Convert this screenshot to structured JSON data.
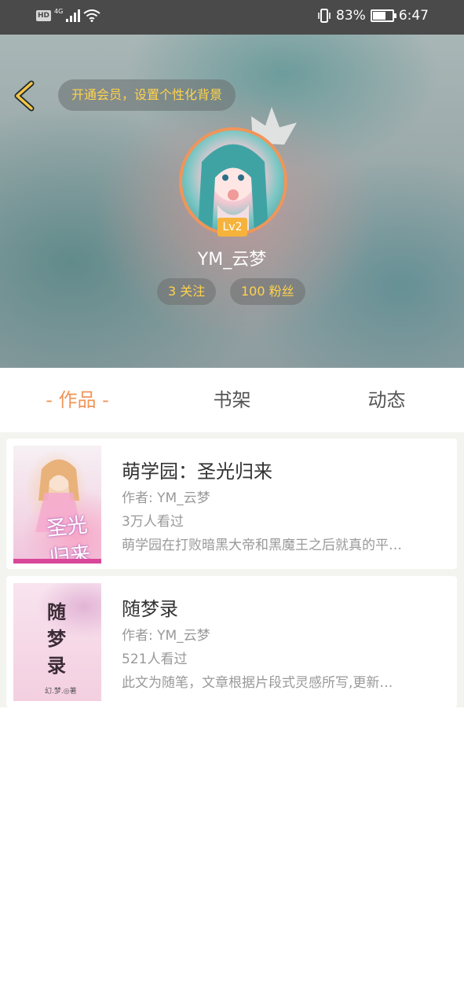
{
  "status_bar": {
    "hd": "HD",
    "network": "4G",
    "battery_percent": "83%",
    "battery_level": 0.83,
    "time": "6:47"
  },
  "header": {
    "vip_prompt": "开通会员，设置个性化背景",
    "level": "Lv2",
    "username": "YM_云梦",
    "following": "3 关注",
    "followers": "100 粉丝"
  },
  "tabs": [
    {
      "label": "- 作品 -",
      "active": true
    },
    {
      "label": "书架",
      "active": false
    },
    {
      "label": "动态",
      "active": false
    }
  ],
  "books": [
    {
      "title": "萌学园：圣光归来",
      "author": "作者: YM_云梦",
      "views": "3万人看过",
      "description": "萌学园在打败暗黑大帝和黑魔王之后就真的平…",
      "cover_text": "圣光归来"
    },
    {
      "title": "随梦录",
      "author": "作者: YM_云梦",
      "views": "521人看过",
      "description": "此文为随笔，文章根据片段式灵感所写,更新…",
      "cover_text": "随梦录",
      "cover_signature": "幻.梦.◎著"
    }
  ],
  "colors": {
    "accent": "#f0955a",
    "gold_text": "#ffd34d",
    "level_badge": "#f5b33c",
    "status_bar": "#4a4a4a"
  },
  "icons": {
    "back": "chevron-left-icon",
    "crown": "crown-icon",
    "wifi": "wifi-icon",
    "signal": "signal-icon",
    "vibrate": "vibrate-icon",
    "battery": "battery-icon"
  }
}
